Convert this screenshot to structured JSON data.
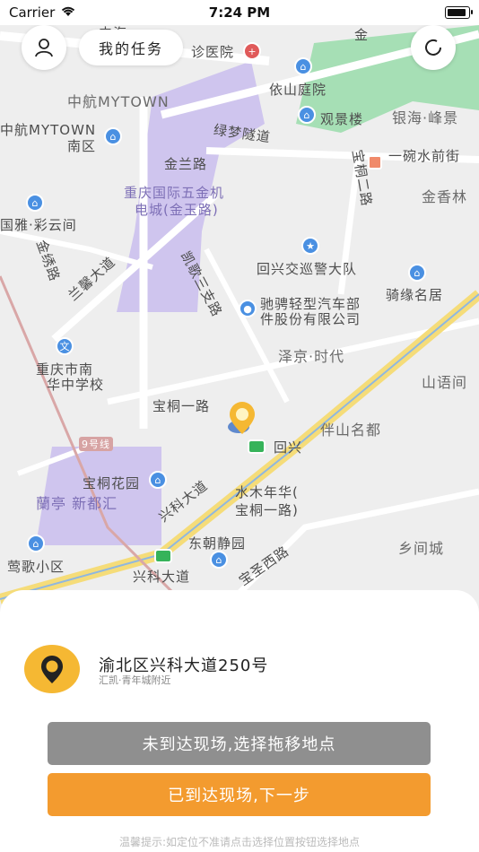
{
  "status_bar": {
    "carrier": "Carrier",
    "time": "7:24 PM"
  },
  "header": {
    "task_label": "我的任务"
  },
  "map": {
    "labels": [
      "中航MYTOWN",
      "中航MYTOWN",
      "南区",
      "金兰路",
      "重庆国际五金机",
      "电城(金玉路)",
      "依山庭院",
      "观景楼",
      "银海·峰景",
      "一碗水前街",
      "金香林",
      "回兴交巡警大队",
      "骑缘名居",
      "驰骋轻型汽车部",
      "件股份有限公司",
      "泽京·时代",
      "山语间",
      "伴山名都",
      "重庆市南",
      "华中学校",
      "宝桐一路",
      "回兴",
      "宝桐花园",
      "蘭亭 新都汇",
      "水木年华(",
      "宝桐一路)",
      "乡间城",
      "东朝静园",
      "兴科大道",
      "兴科大道",
      "莺歌小区",
      "国雅·彩云间",
      "9号线",
      "绿梦隧道",
      "兰馨大道",
      "凯歌三支路",
      "宝桐二路",
      "金绣路",
      "宝圣西路",
      "诊医院",
      "中海",
      "金"
    ]
  },
  "location": {
    "address": "渝北区兴科大道250号",
    "nearby": "汇凯·青年城附近"
  },
  "actions": {
    "not_arrived": "未到达现场,选择拖移地点",
    "arrived": "已到达现场,下一步"
  },
  "tip": "温馨提示:如定位不准请点击选择位置按钮选择地点",
  "colors": {
    "primary_button": "#f39b2f",
    "secondary_button": "#8f8f8f",
    "marker": "#f5b833"
  }
}
